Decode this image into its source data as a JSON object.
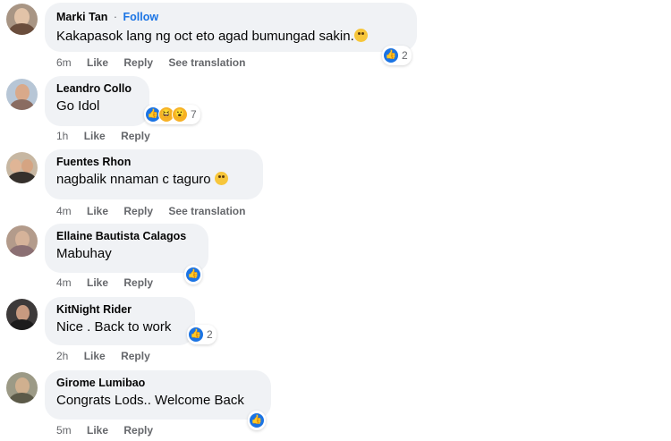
{
  "comments": [
    {
      "author": "Marki Tan",
      "follow_label": "Follow",
      "separator": "·",
      "text": "Kakapasok lang ng oct eto agad bumungad sakin.",
      "time": "6m",
      "like_label": "Like",
      "reply_label": "Reply",
      "translation_label": "See translation",
      "reaction_count": "2",
      "inline_emoji": "sad-face-emoji-icon"
    },
    {
      "author": "Leandro Collo",
      "text": "Go Idol",
      "time": "1h",
      "like_label": "Like",
      "reply_label": "Reply",
      "reaction_count": "7"
    },
    {
      "author": "Fuentes Rhon",
      "text": "nagbalik nnaman c taguro",
      "time": "4m",
      "like_label": "Like",
      "reply_label": "Reply",
      "translation_label": "See translation",
      "inline_emoji": "laughing-emoji-icon"
    },
    {
      "author": "Ellaine Bautista Calagos",
      "text": "Mabuhay",
      "time": "4m",
      "like_label": "Like",
      "reply_label": "Reply"
    },
    {
      "author": "KitNight Rider",
      "text": "Nice . Back to work",
      "time": "2h",
      "like_label": "Like",
      "reply_label": "Reply",
      "reaction_count": "2"
    },
    {
      "author": "Girome Lumibao",
      "text": "Congrats Lods.. Welcome Back",
      "time": "5m",
      "like_label": "Like",
      "reply_label": "Reply"
    }
  ],
  "colors": {
    "bubble": "#f0f2f5",
    "link_blue": "#1b74e4",
    "muted_text": "#65676b"
  },
  "icons": {
    "like": "like-thumb-icon",
    "haha": "haha-reaction-icon",
    "wow": "wow-reaction-icon"
  }
}
